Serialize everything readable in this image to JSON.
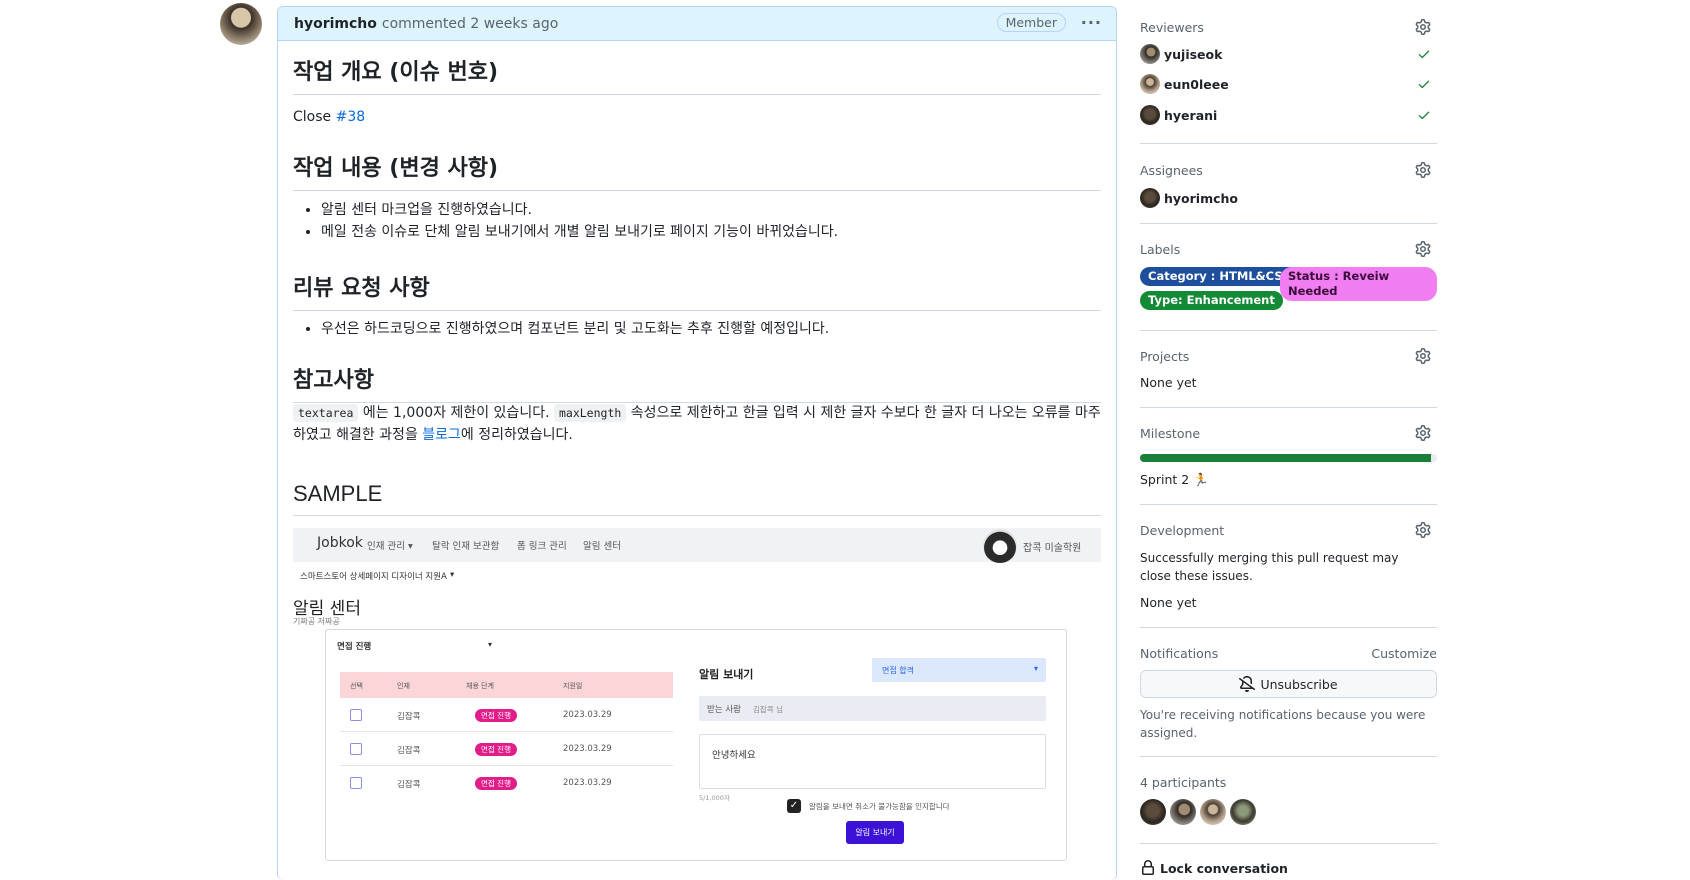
{
  "comment": {
    "author": "hyorimcho",
    "meta": "commented 2 weeks ago",
    "badge": "Member",
    "sections": {
      "overview_title": "작업 개요 (이슈 번호)",
      "close_prefix": "Close",
      "close_issue": "#38",
      "changes_title": "작업 내용 (변경 사항)",
      "changes": [
        "알림 센터 마크업을 진행하였습니다.",
        "메일 전송 이슈로 단체 알림 보내기에서 개별 알림 보내기로 페이지 기능이 바뀌었습니다."
      ],
      "review_title": "리뷰 요청 사항",
      "review_items": [
        "우선은 하드코딩으로 진행하였으며 컴포넌트 분리 및 고도화는 추후 진행할 예정입니다."
      ],
      "notes_title": "참고사항",
      "notes": {
        "code1": "textarea",
        "text1": "에는 1,000자 제한이 있습니다.",
        "code2": "maxLength",
        "text2": "속성으로 제한하고 한글 입력 시 제한 글자 수보다 한 글자 더 나오는 오류를 마주하였고 해결한 과정을",
        "link": "블로그",
        "text3": "에 정리하였습니다."
      },
      "sample_title": "SAMPLE"
    }
  },
  "sample_screenshot": {
    "logo": "Jobkok",
    "nav": [
      "인재 관리 ▾",
      "탈락 인재 보관함",
      "폼 링크 관리",
      "알림 센터"
    ],
    "user": "잡콕 미술학원",
    "subheader": "스마트스토어 상세페이지 디자이너 지원A",
    "title": "알림 센터",
    "tiny": "기짜공 저짜공",
    "filter": "면접 진행",
    "headers": [
      "선택",
      "인재",
      "채용 단계",
      "지원일"
    ],
    "rows": [
      {
        "name": "김잡콕",
        "stage": "면접 진행",
        "date": "2023.03.29"
      },
      {
        "name": "김잡콕",
        "stage": "면접 진행",
        "date": "2023.03.29"
      },
      {
        "name": "김잡콕",
        "stage": "면접 진행",
        "date": "2023.03.29"
      }
    ],
    "send_title": "알림 보내기",
    "send_select": "면접 합격",
    "recipient_label": "받는 사람",
    "recipient_value": "김잡콕 님",
    "message": "안녕하세요",
    "counter": "5/1,000자",
    "confirm_text": "알림을 보내면 취소가 불가능함을 인지합니다",
    "send_button": "알림 보내기"
  },
  "sidebar": {
    "reviewers_title": "Reviewers",
    "reviewers": [
      "yujiseok",
      "eun0leee",
      "hyerani"
    ],
    "assignees_title": "Assignees",
    "assignees": [
      "hyorimcho"
    ],
    "labels_title": "Labels",
    "labels": [
      {
        "text": "Category : HTML&CSS",
        "bg": "#1d4f9c",
        "fg": "#ffffff"
      },
      {
        "text": "Status : Reveiw Needed",
        "bg": "#f07ef0",
        "fg": "#3b0a3b"
      },
      {
        "text": "Type: Enhancement",
        "bg": "#138a36",
        "fg": "#ffffff"
      }
    ],
    "projects_title": "Projects",
    "projects_value": "None yet",
    "milestone_title": "Milestone",
    "milestone_progress": 0.98,
    "milestone_name": "Sprint 2 🏃",
    "development_title": "Development",
    "development_text": "Successfully merging this pull request may close these issues.",
    "development_value": "None yet",
    "notifications_title": "Notifications",
    "customize": "Customize",
    "unsubscribe": "Unsubscribe",
    "notif_reason": "You're receiving notifications because you were assigned.",
    "participants_title": "4 participants",
    "lock": "Lock conversation"
  },
  "colors": {
    "accent": "#0969da",
    "success": "#1a7f37",
    "header_bg": "#ddf4ff"
  }
}
